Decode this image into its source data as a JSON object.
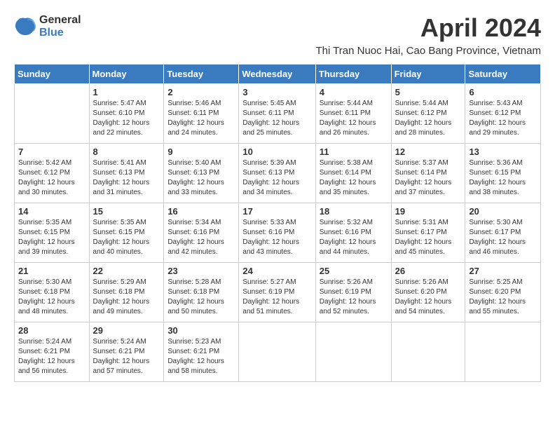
{
  "logo": {
    "general": "General",
    "blue": "Blue"
  },
  "header": {
    "month": "April 2024",
    "location": "Thi Tran Nuoc Hai, Cao Bang Province, Vietnam"
  },
  "weekdays": [
    "Sunday",
    "Monday",
    "Tuesday",
    "Wednesday",
    "Thursday",
    "Friday",
    "Saturday"
  ],
  "weeks": [
    [
      {
        "day": "",
        "info": ""
      },
      {
        "day": "1",
        "info": "Sunrise: 5:47 AM\nSunset: 6:10 PM\nDaylight: 12 hours\nand 22 minutes."
      },
      {
        "day": "2",
        "info": "Sunrise: 5:46 AM\nSunset: 6:11 PM\nDaylight: 12 hours\nand 24 minutes."
      },
      {
        "day": "3",
        "info": "Sunrise: 5:45 AM\nSunset: 6:11 PM\nDaylight: 12 hours\nand 25 minutes."
      },
      {
        "day": "4",
        "info": "Sunrise: 5:44 AM\nSunset: 6:11 PM\nDaylight: 12 hours\nand 26 minutes."
      },
      {
        "day": "5",
        "info": "Sunrise: 5:44 AM\nSunset: 6:12 PM\nDaylight: 12 hours\nand 28 minutes."
      },
      {
        "day": "6",
        "info": "Sunrise: 5:43 AM\nSunset: 6:12 PM\nDaylight: 12 hours\nand 29 minutes."
      }
    ],
    [
      {
        "day": "7",
        "info": "Sunrise: 5:42 AM\nSunset: 6:12 PM\nDaylight: 12 hours\nand 30 minutes."
      },
      {
        "day": "8",
        "info": "Sunrise: 5:41 AM\nSunset: 6:13 PM\nDaylight: 12 hours\nand 31 minutes."
      },
      {
        "day": "9",
        "info": "Sunrise: 5:40 AM\nSunset: 6:13 PM\nDaylight: 12 hours\nand 33 minutes."
      },
      {
        "day": "10",
        "info": "Sunrise: 5:39 AM\nSunset: 6:13 PM\nDaylight: 12 hours\nand 34 minutes."
      },
      {
        "day": "11",
        "info": "Sunrise: 5:38 AM\nSunset: 6:14 PM\nDaylight: 12 hours\nand 35 minutes."
      },
      {
        "day": "12",
        "info": "Sunrise: 5:37 AM\nSunset: 6:14 PM\nDaylight: 12 hours\nand 37 minutes."
      },
      {
        "day": "13",
        "info": "Sunrise: 5:36 AM\nSunset: 6:15 PM\nDaylight: 12 hours\nand 38 minutes."
      }
    ],
    [
      {
        "day": "14",
        "info": "Sunrise: 5:35 AM\nSunset: 6:15 PM\nDaylight: 12 hours\nand 39 minutes."
      },
      {
        "day": "15",
        "info": "Sunrise: 5:35 AM\nSunset: 6:15 PM\nDaylight: 12 hours\nand 40 minutes."
      },
      {
        "day": "16",
        "info": "Sunrise: 5:34 AM\nSunset: 6:16 PM\nDaylight: 12 hours\nand 42 minutes."
      },
      {
        "day": "17",
        "info": "Sunrise: 5:33 AM\nSunset: 6:16 PM\nDaylight: 12 hours\nand 43 minutes."
      },
      {
        "day": "18",
        "info": "Sunrise: 5:32 AM\nSunset: 6:16 PM\nDaylight: 12 hours\nand 44 minutes."
      },
      {
        "day": "19",
        "info": "Sunrise: 5:31 AM\nSunset: 6:17 PM\nDaylight: 12 hours\nand 45 minutes."
      },
      {
        "day": "20",
        "info": "Sunrise: 5:30 AM\nSunset: 6:17 PM\nDaylight: 12 hours\nand 46 minutes."
      }
    ],
    [
      {
        "day": "21",
        "info": "Sunrise: 5:30 AM\nSunset: 6:18 PM\nDaylight: 12 hours\nand 48 minutes."
      },
      {
        "day": "22",
        "info": "Sunrise: 5:29 AM\nSunset: 6:18 PM\nDaylight: 12 hours\nand 49 minutes."
      },
      {
        "day": "23",
        "info": "Sunrise: 5:28 AM\nSunset: 6:18 PM\nDaylight: 12 hours\nand 50 minutes."
      },
      {
        "day": "24",
        "info": "Sunrise: 5:27 AM\nSunset: 6:19 PM\nDaylight: 12 hours\nand 51 minutes."
      },
      {
        "day": "25",
        "info": "Sunrise: 5:26 AM\nSunset: 6:19 PM\nDaylight: 12 hours\nand 52 minutes."
      },
      {
        "day": "26",
        "info": "Sunrise: 5:26 AM\nSunset: 6:20 PM\nDaylight: 12 hours\nand 54 minutes."
      },
      {
        "day": "27",
        "info": "Sunrise: 5:25 AM\nSunset: 6:20 PM\nDaylight: 12 hours\nand 55 minutes."
      }
    ],
    [
      {
        "day": "28",
        "info": "Sunrise: 5:24 AM\nSunset: 6:21 PM\nDaylight: 12 hours\nand 56 minutes."
      },
      {
        "day": "29",
        "info": "Sunrise: 5:24 AM\nSunset: 6:21 PM\nDaylight: 12 hours\nand 57 minutes."
      },
      {
        "day": "30",
        "info": "Sunrise: 5:23 AM\nSunset: 6:21 PM\nDaylight: 12 hours\nand 58 minutes."
      },
      {
        "day": "",
        "info": ""
      },
      {
        "day": "",
        "info": ""
      },
      {
        "day": "",
        "info": ""
      },
      {
        "day": "",
        "info": ""
      }
    ]
  ]
}
